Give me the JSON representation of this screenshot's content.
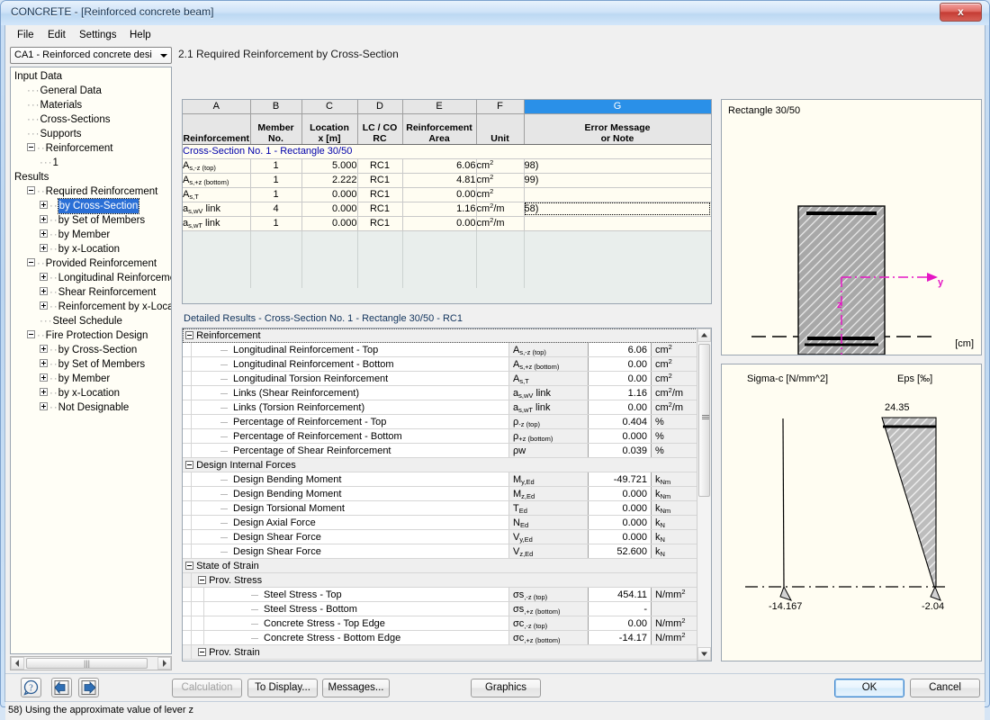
{
  "window": {
    "title": "CONCRETE - [Reinforced concrete beam]",
    "close_label": "x"
  },
  "menu": {
    "items": [
      "File",
      "Edit",
      "Settings",
      "Help"
    ]
  },
  "sidebar": {
    "combo_value": "CA1 - Reinforced concrete desi",
    "tree": [
      {
        "label": "Input Data",
        "depth": 0,
        "expander": "none"
      },
      {
        "label": "General Data",
        "depth": 1,
        "expander": "none"
      },
      {
        "label": "Materials",
        "depth": 1,
        "expander": "none"
      },
      {
        "label": "Cross-Sections",
        "depth": 1,
        "expander": "none"
      },
      {
        "label": "Supports",
        "depth": 1,
        "expander": "none"
      },
      {
        "label": "Reinforcement",
        "depth": 1,
        "expander": "minus"
      },
      {
        "label": "1",
        "depth": 2,
        "expander": "none"
      },
      {
        "label": "Results",
        "depth": 0,
        "expander": "none"
      },
      {
        "label": "Required Reinforcement",
        "depth": 1,
        "expander": "minus"
      },
      {
        "label": "by Cross-Section",
        "depth": 2,
        "expander": "plus",
        "selected": true
      },
      {
        "label": "by Set of Members",
        "depth": 2,
        "expander": "plus"
      },
      {
        "label": "by Member",
        "depth": 2,
        "expander": "plus"
      },
      {
        "label": "by x-Location",
        "depth": 2,
        "expander": "plus"
      },
      {
        "label": "Provided Reinforcement",
        "depth": 1,
        "expander": "minus"
      },
      {
        "label": "Longitudinal Reinforcement",
        "depth": 2,
        "expander": "plus"
      },
      {
        "label": "Shear Reinforcement",
        "depth": 2,
        "expander": "plus"
      },
      {
        "label": "Reinforcement by x-Locatio",
        "depth": 2,
        "expander": "plus"
      },
      {
        "label": "Steel Schedule",
        "depth": 2,
        "expander": "none"
      },
      {
        "label": "Fire Protection Design",
        "depth": 1,
        "expander": "minus"
      },
      {
        "label": "by Cross-Section",
        "depth": 2,
        "expander": "plus"
      },
      {
        "label": "by Set of Members",
        "depth": 2,
        "expander": "plus"
      },
      {
        "label": "by Member",
        "depth": 2,
        "expander": "plus"
      },
      {
        "label": "by x-Location",
        "depth": 2,
        "expander": "plus"
      },
      {
        "label": "Not Designable",
        "depth": 2,
        "expander": "plus"
      }
    ]
  },
  "main": {
    "title": "2.1 Required Reinforcement by Cross-Section"
  },
  "top_table": {
    "column_letters": [
      "A",
      "B",
      "C",
      "D",
      "E",
      "F",
      "G"
    ],
    "selected_column_letter": "G",
    "headers": [
      {
        "line1": "",
        "line2": "Reinforcement"
      },
      {
        "line1": "Member",
        "line2": "No."
      },
      {
        "line1": "Location",
        "line2": "x [m]"
      },
      {
        "line1": "LC / CO",
        "line2": "RC"
      },
      {
        "line1": "Reinforcement",
        "line2": "Area"
      },
      {
        "line1": "",
        "line2": "Unit"
      },
      {
        "line1": "Error Message",
        "line2": "or Note"
      }
    ],
    "group_row": "Cross-Section No. 1 - Rectangle 30/50",
    "rows": [
      {
        "reinforcement": "As,-z (top)",
        "member": "1",
        "location": "5.000",
        "lc": "RC1",
        "area": "6.06",
        "unit": "cm2",
        "note": "98)"
      },
      {
        "reinforcement": "As,+z (bottom)",
        "member": "1",
        "location": "2.222",
        "lc": "RC1",
        "area": "4.81",
        "unit": "cm2",
        "note": "99)"
      },
      {
        "reinforcement": "As,T",
        "member": "1",
        "location": "0.000",
        "lc": "RC1",
        "area": "0.00",
        "unit": "cm2",
        "note": ""
      },
      {
        "reinforcement": "as,wV link",
        "member": "4",
        "location": "0.000",
        "lc": "RC1",
        "area": "1.16",
        "unit": "cm2/m",
        "note": "58)",
        "focused": true
      },
      {
        "reinforcement": "as,wT link",
        "member": "1",
        "location": "0.000",
        "lc": "RC1",
        "area": "0.00",
        "unit": "cm2/m",
        "note": ""
      }
    ]
  },
  "detail": {
    "header": "Detailed Results  -  Cross-Section No. 1 - Rectangle 30/50  -  RC1",
    "rows": [
      {
        "kind": "group",
        "level": 0,
        "label": "Reinforcement",
        "focused": true
      },
      {
        "kind": "item",
        "level": 1,
        "label": "Longitudinal Reinforcement - Top",
        "symbol": "As,-z (top)",
        "value": "6.06",
        "unit": "cm2"
      },
      {
        "kind": "item",
        "level": 1,
        "label": "Longitudinal Reinforcement - Bottom",
        "symbol": "As,+z (bottom)",
        "value": "0.00",
        "unit": "cm2"
      },
      {
        "kind": "item",
        "level": 1,
        "label": "Longitudinal Torsion Reinforcement",
        "symbol": "As,T",
        "value": "0.00",
        "unit": "cm2"
      },
      {
        "kind": "item",
        "level": 1,
        "label": "Links (Shear Reinforcement)",
        "symbol": "as,wV link",
        "value": "1.16",
        "unit": "cm2/m"
      },
      {
        "kind": "item",
        "level": 1,
        "label": "Links (Torsion Reinforcement)",
        "symbol": "as,wT link",
        "value": "0.00",
        "unit": "cm2/m"
      },
      {
        "kind": "item",
        "level": 1,
        "label": "Percentage of Reinforcement - Top",
        "symbol": "ρ-z (top)",
        "value": "0.404",
        "unit": "%"
      },
      {
        "kind": "item",
        "level": 1,
        "label": "Percentage of Reinforcement - Bottom",
        "symbol": "ρ+z (bottom)",
        "value": "0.000",
        "unit": "%"
      },
      {
        "kind": "item",
        "level": 1,
        "label": "Percentage of Shear Reinforcement",
        "symbol": "ρw",
        "value": "0.039",
        "unit": "%"
      },
      {
        "kind": "group",
        "level": 0,
        "label": "Design Internal Forces"
      },
      {
        "kind": "item",
        "level": 1,
        "label": "Design Bending Moment",
        "symbol": "My,Ed",
        "value": "-49.721",
        "unit": "kNm"
      },
      {
        "kind": "item",
        "level": 1,
        "label": "Design Bending Moment",
        "symbol": "Mz,Ed",
        "value": "0.000",
        "unit": "kNm"
      },
      {
        "kind": "item",
        "level": 1,
        "label": "Design Torsional Moment",
        "symbol": "TEd",
        "value": "0.000",
        "unit": "kNm"
      },
      {
        "kind": "item",
        "level": 1,
        "label": "Design Axial Force",
        "symbol": "NEd",
        "value": "0.000",
        "unit": "kN"
      },
      {
        "kind": "item",
        "level": 1,
        "label": "Design Shear Force",
        "symbol": "Vy,Ed",
        "value": "0.000",
        "unit": "kN"
      },
      {
        "kind": "item",
        "level": 1,
        "label": "Design Shear Force",
        "symbol": "Vz,Ed",
        "value": "52.600",
        "unit": "kN"
      },
      {
        "kind": "group",
        "level": 0,
        "label": "State of Strain"
      },
      {
        "kind": "group",
        "level": 1,
        "label": "Prov. Stress"
      },
      {
        "kind": "item",
        "level": 2,
        "label": "Steel Stress - Top",
        "symbol": "σs,-z (top)",
        "value": "454.11",
        "unit": "N/mm2"
      },
      {
        "kind": "item",
        "level": 2,
        "label": "Steel Stress - Bottom",
        "symbol": "σs,+z (bottom)",
        "value": "-",
        "unit": ""
      },
      {
        "kind": "item",
        "level": 2,
        "label": "Concrete Stress - Top Edge",
        "symbol": "σc,-z (top)",
        "value": "0.00",
        "unit": "N/mm2"
      },
      {
        "kind": "item",
        "level": 2,
        "label": "Concrete Stress - Bottom Edge",
        "symbol": "σc,+z (bottom)",
        "value": "-14.17",
        "unit": "N/mm2"
      },
      {
        "kind": "group",
        "level": 1,
        "label": "Prov. Strain"
      }
    ]
  },
  "cross_section": {
    "title": "Rectangle 30/50",
    "unit_label": "[cm]",
    "axis_y_label": "y",
    "axis_z_label": "z"
  },
  "stress_diagram": {
    "left_title": "Sigma-c [N/mm^2]",
    "right_title": "Eps [‰]",
    "top_value": "24.35",
    "left_bottom_value": "-14.167",
    "right_bottom_value": "-2.04"
  },
  "toolbar": {
    "help_icon": "help-icon",
    "prev_icon": "previous-icon",
    "next_icon": "next-icon",
    "calculation_label": "Calculation",
    "to_display_label": "To Display...",
    "messages_label": "Messages...",
    "graphics_label": "Graphics",
    "ok_label": "OK",
    "cancel_label": "Cancel"
  },
  "statusbar": {
    "text": "58) Using the approximate value of lever z"
  }
}
